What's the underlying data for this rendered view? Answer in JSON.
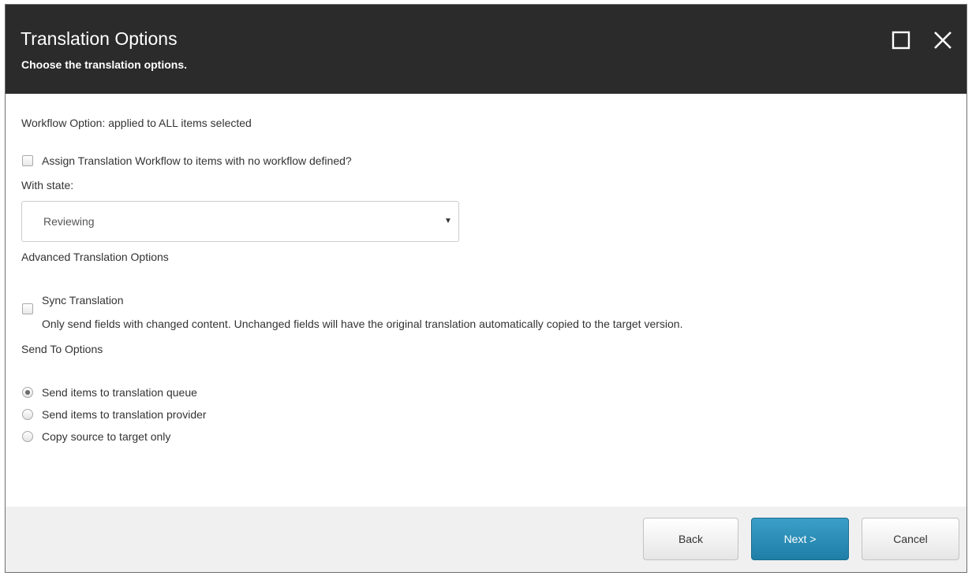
{
  "dialog": {
    "title": "Translation Options",
    "subtitle": "Choose the translation options.",
    "icons": {
      "maximize": "maximize-icon",
      "close": "close-icon"
    }
  },
  "workflow": {
    "heading": "Workflow Option: applied to ALL items selected",
    "assign_checkbox": {
      "label": "Assign Translation Workflow to items with no workflow defined?",
      "checked": false
    },
    "state_label": "With state:",
    "state_select": {
      "value": "Reviewing",
      "arrow": "▼"
    }
  },
  "advanced": {
    "heading": "Advanced Translation Options",
    "sync_checkbox": {
      "label": "Sync Translation",
      "description": "Only send fields with changed content. Unchanged fields will have the original translation automatically copied to the target version.",
      "checked": false
    }
  },
  "send_to": {
    "heading": "Send To Options",
    "options": [
      {
        "label": "Send items to translation queue",
        "selected": true
      },
      {
        "label": "Send items to translation provider",
        "selected": false
      },
      {
        "label": "Copy source to target only",
        "selected": false
      }
    ]
  },
  "footer": {
    "back_label": "Back",
    "next_label": "Next >",
    "cancel_label": "Cancel"
  },
  "colors": {
    "header_bg": "#2b2b2b",
    "primary_button": "#2a8db8",
    "footer_bg": "#f0f0f0"
  }
}
